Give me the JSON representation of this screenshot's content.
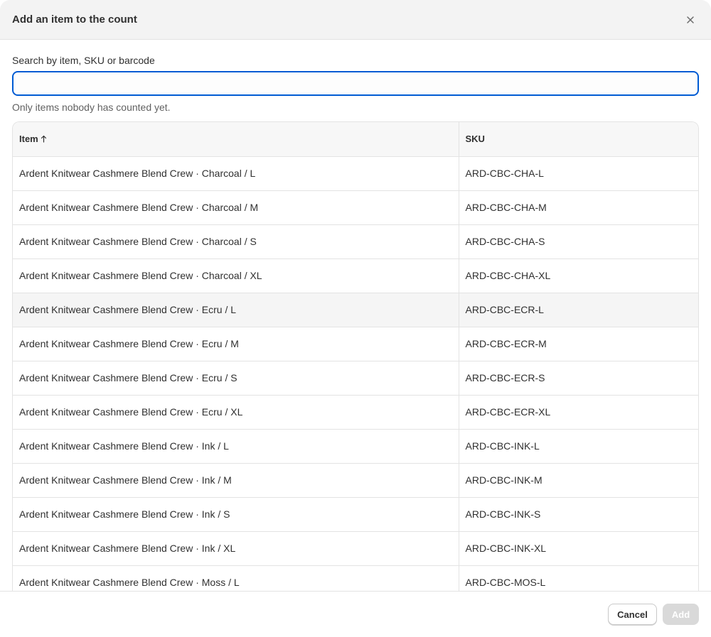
{
  "dialog": {
    "title": "Add an item to the count",
    "close_icon": "close-icon"
  },
  "search": {
    "label": "Search by item, SKU or barcode",
    "value": "",
    "placeholder": "",
    "help": "Only items nobody has counted yet."
  },
  "table": {
    "columns": [
      "Item",
      "SKU"
    ],
    "sort_icon": "arrow-up-icon",
    "rows": [
      {
        "item": "Ardent Knitwear Cashmere Blend Crew · Charcoal / L",
        "sku": "ARD-CBC-CHA-L"
      },
      {
        "item": "Ardent Knitwear Cashmere Blend Crew · Charcoal / M",
        "sku": "ARD-CBC-CHA-M"
      },
      {
        "item": "Ardent Knitwear Cashmere Blend Crew · Charcoal / S",
        "sku": "ARD-CBC-CHA-S"
      },
      {
        "item": "Ardent Knitwear Cashmere Blend Crew · Charcoal / XL",
        "sku": "ARD-CBC-CHA-XL"
      },
      {
        "item": "Ardent Knitwear Cashmere Blend Crew · Ecru / L",
        "sku": "ARD-CBC-ECR-L"
      },
      {
        "item": "Ardent Knitwear Cashmere Blend Crew · Ecru / M",
        "sku": "ARD-CBC-ECR-M"
      },
      {
        "item": "Ardent Knitwear Cashmere Blend Crew · Ecru / S",
        "sku": "ARD-CBC-ECR-S"
      },
      {
        "item": "Ardent Knitwear Cashmere Blend Crew · Ecru / XL",
        "sku": "ARD-CBC-ECR-XL"
      },
      {
        "item": "Ardent Knitwear Cashmere Blend Crew · Ink / L",
        "sku": "ARD-CBC-INK-L"
      },
      {
        "item": "Ardent Knitwear Cashmere Blend Crew · Ink / M",
        "sku": "ARD-CBC-INK-M"
      },
      {
        "item": "Ardent Knitwear Cashmere Blend Crew · Ink / S",
        "sku": "ARD-CBC-INK-S"
      },
      {
        "item": "Ardent Knitwear Cashmere Blend Crew · Ink / XL",
        "sku": "ARD-CBC-INK-XL"
      },
      {
        "item": "Ardent Knitwear Cashmere Blend Crew · Moss / L",
        "sku": "ARD-CBC-MOS-L"
      }
    ]
  },
  "footer": {
    "cancel_label": "Cancel",
    "add_label": "Add"
  },
  "colors": {
    "focus_ring": "#005bd3",
    "header_bg": "#f3f3f3",
    "disabled_button": "#d9d9d9"
  }
}
